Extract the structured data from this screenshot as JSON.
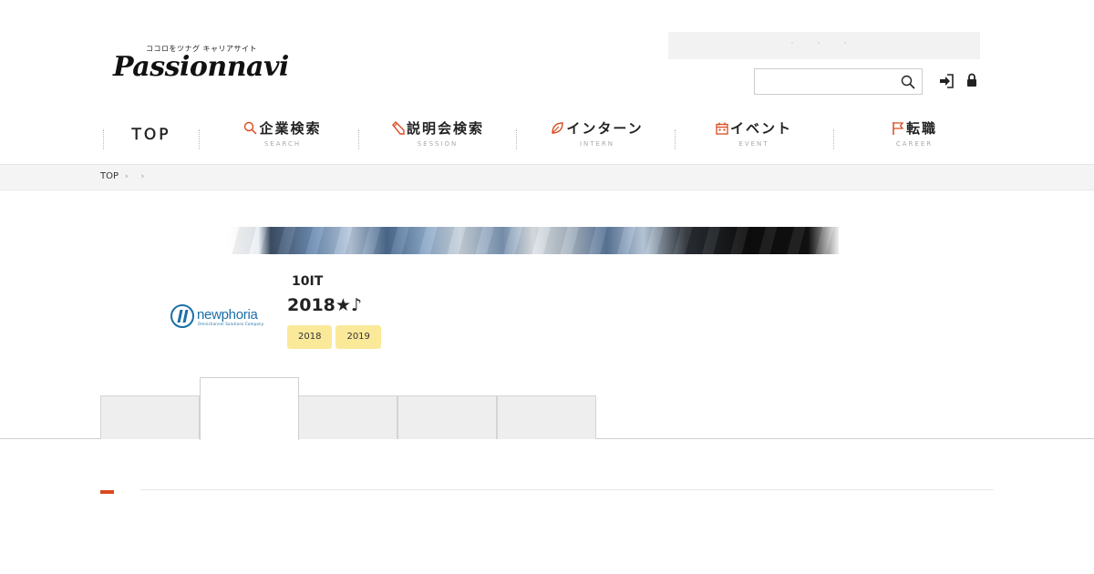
{
  "header": {
    "logo": {
      "tagline": "ココロをツナグ キャリアサイト",
      "wordmark": "Passionnavi"
    },
    "top_bar_text": "· · ·",
    "search": {
      "value": "",
      "placeholder": ""
    }
  },
  "nav": {
    "items": [
      {
        "id": "top",
        "label": "TOP",
        "sub": ""
      },
      {
        "id": "search",
        "label": "企業検索",
        "sub": "SEARCH",
        "icon": "search-icon"
      },
      {
        "id": "session",
        "label": "説明会検索",
        "sub": "SESSION",
        "icon": "pencil-icon"
      },
      {
        "id": "intern",
        "label": "インターン",
        "sub": "INTERN",
        "icon": "leaf-icon"
      },
      {
        "id": "event",
        "label": "イベント",
        "sub": "EVENT",
        "icon": "calendar-icon"
      },
      {
        "id": "career",
        "label": "転職",
        "sub": "CAREER",
        "icon": "flag-icon"
      }
    ],
    "accent_color": "#d94a1e"
  },
  "breadcrumb": {
    "items": [
      "TOP",
      "",
      ""
    ],
    "separator": "›"
  },
  "company": {
    "logo_text": "newphoria",
    "logo_tagline": "Omnichannel Solutions Company",
    "category": "10IT",
    "title": "2018★♪",
    "tags": [
      "2018",
      "2019"
    ],
    "tag_color": "#fbe99a",
    "logo_color": "#1b6fa8"
  },
  "tabs": {
    "items": [
      "",
      "",
      "",
      "",
      ""
    ],
    "active_index": 1
  }
}
